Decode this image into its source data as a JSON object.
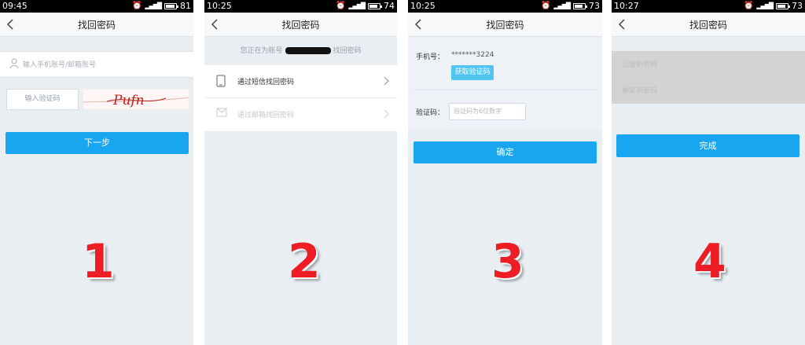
{
  "screens": [
    {
      "status": {
        "time": "09:45",
        "battery": "81",
        "battery_level": 0.81
      },
      "title": "找回密码",
      "account_placeholder": "输入手机账号/邮箱账号",
      "code_placeholder": "输入验证码",
      "captcha_text": "Pufn",
      "next_button": "下一步",
      "step": "1"
    },
    {
      "status": {
        "time": "10:25",
        "battery": "74",
        "battery_level": 0.74
      },
      "title": "找回密码",
      "info_prefix": "您正在为账号",
      "info_suffix": "找回密码",
      "options": [
        {
          "label": "通过短信找回密码",
          "icon": "phone-icon",
          "enabled": true
        },
        {
          "label": "通过邮箱找回密码",
          "icon": "mail-icon",
          "enabled": false
        }
      ],
      "step": "2"
    },
    {
      "status": {
        "time": "10:25",
        "battery": "73",
        "battery_level": 0.73
      },
      "title": "找回密码",
      "phone_label": "手机号：",
      "phone_value": "*******3224",
      "get_code_button": "获取验证码",
      "code_label": "验证码：",
      "code_placeholder": "验证码为6位数字",
      "confirm_button": "确定",
      "step": "3"
    },
    {
      "status": {
        "time": "10:27",
        "battery": "73",
        "battery_level": 0.73
      },
      "title": "找回密码",
      "new_password_placeholder": "设置新密码",
      "repeat_password_placeholder": "重复新密码",
      "done_button": "完成",
      "step": "4"
    }
  ],
  "colors": {
    "accent": "#19a6f0",
    "get_code": "#52c4f2",
    "step_number": "#ee1c25",
    "background": "#e9eef3"
  }
}
